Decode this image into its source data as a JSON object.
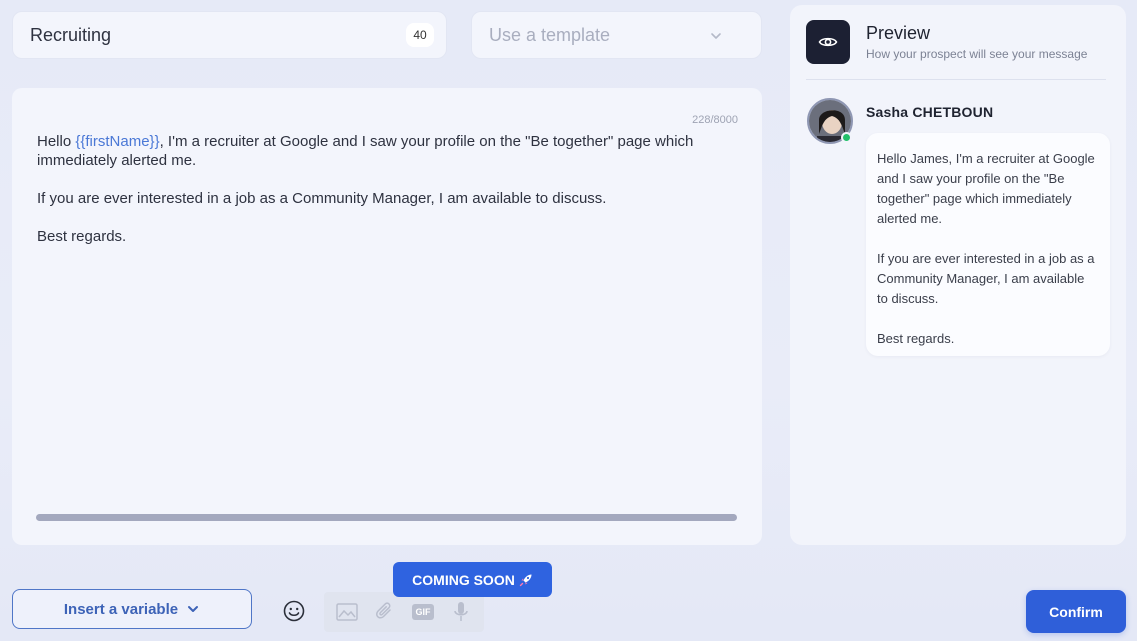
{
  "header": {
    "title_value": "Recruiting",
    "title_counter": "40",
    "template_placeholder": "Use a template"
  },
  "editor": {
    "char_count": "228/8000",
    "paragraphs": [
      {
        "before": "Hello ",
        "variable": "{{firstName}}",
        "after": ", I'm a recruiter at Google and I saw your profile on the \"Be together\" page which immediately alerted me."
      },
      {
        "text": "If you are ever interested in a job as a Community Manager, I am available to discuss."
      },
      {
        "text": "Best regards."
      }
    ]
  },
  "preview": {
    "title": "Preview",
    "subtitle": "How your prospect will see your message",
    "sender_name": "Sasha CHETBOUN",
    "sender_status": "online",
    "bubble_paragraphs": [
      "Hello James, I'm a recruiter at Google and I saw your profile on the \"Be together\" page which immediately alerted me.",
      "If you are ever interested in a job as a Community Manager, I am available to discuss.",
      "Best regards."
    ]
  },
  "toolbar": {
    "insert_variable_label": "Insert a variable",
    "coming_soon_label": "COMING SOON",
    "coming_soon_icon": "rocket-icon",
    "tools": [
      "emoji-icon",
      "image-icon",
      "attachment-icon",
      "gif-icon",
      "microphone-icon"
    ],
    "gif_label": "GIF",
    "confirm_label": "Confirm"
  },
  "colors": {
    "accent": "#2f5fd9",
    "variable": "#4a78d6",
    "online": "#22c06a",
    "dark_icon_bg": "#1c2033"
  }
}
